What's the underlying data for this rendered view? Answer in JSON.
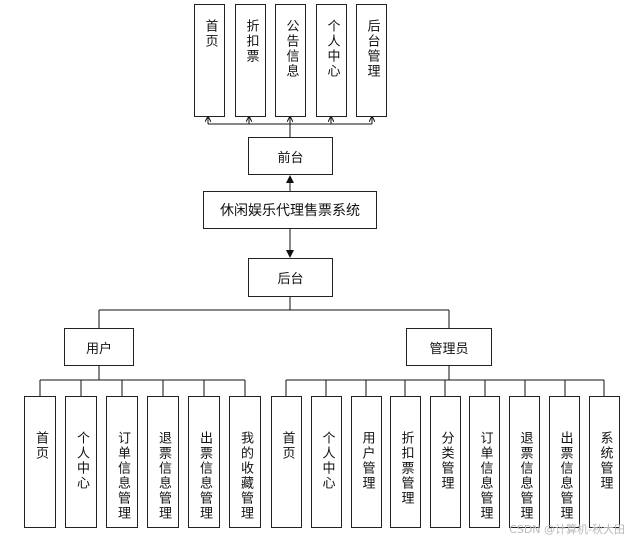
{
  "front_items": [
    "首页",
    "折扣票",
    "公告信息",
    "个人中心",
    "后台管理"
  ],
  "front_label": "前台",
  "system_label": "休闲娱乐代理售票系统",
  "back_label": "后台",
  "user_label": "用户",
  "admin_label": "管理员",
  "user_items": [
    "首页",
    "个人中心",
    "订单信息管理",
    "退票信息管理",
    "出票信息管理",
    "我的收藏管理"
  ],
  "admin_items": [
    "首页",
    "个人中心",
    "用户管理",
    "折扣票管理",
    "分类管理",
    "订单信息管理",
    "退票信息管理",
    "出票信息管理",
    "系统管理"
  ],
  "watermark": "CSDN @计算机-秋大田"
}
